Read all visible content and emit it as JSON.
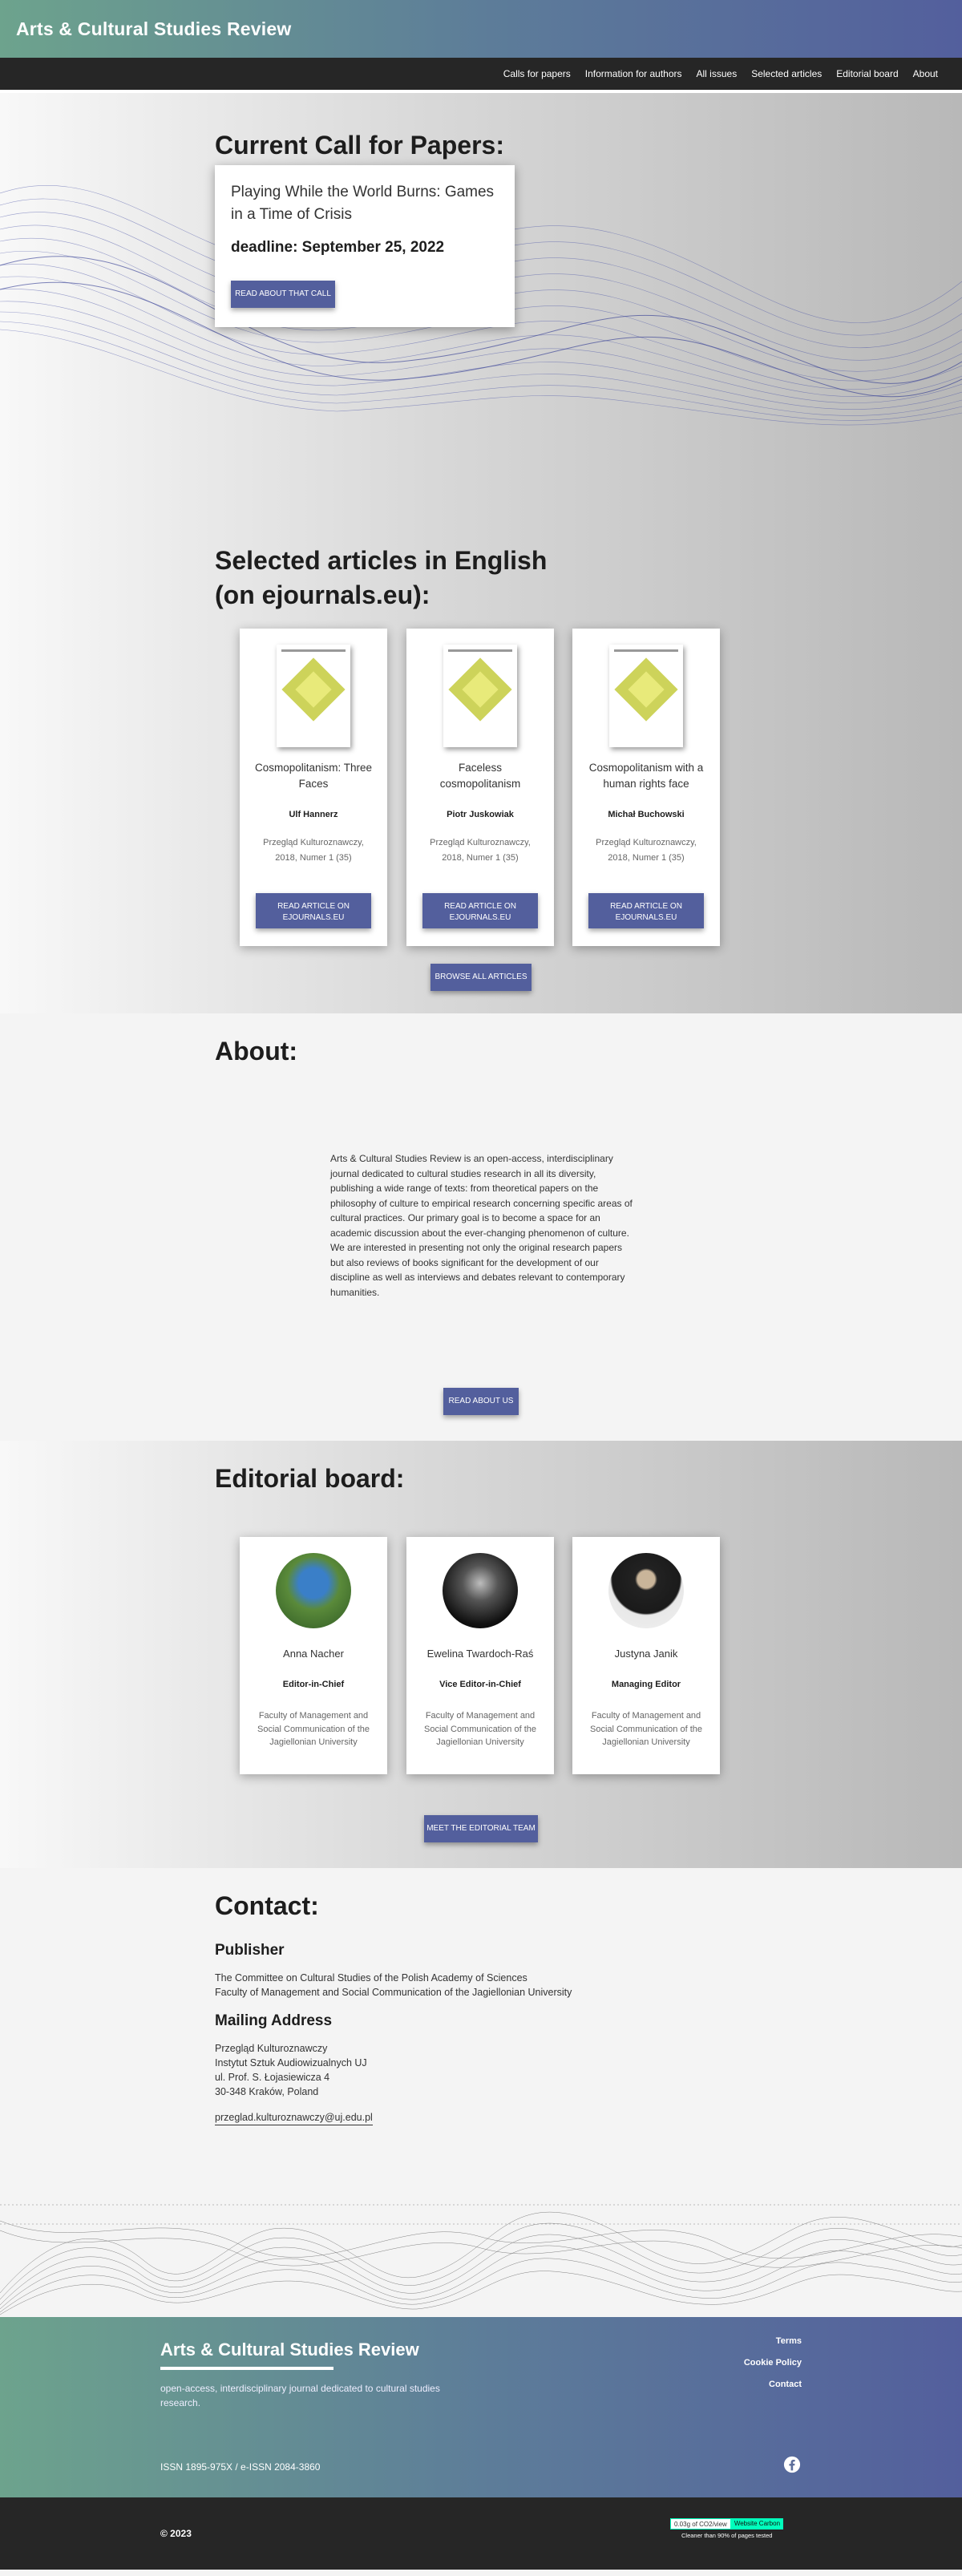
{
  "header": {
    "title": "Arts & Cultural Studies Review"
  },
  "nav": [
    "Calls for papers",
    "Information for authors",
    "All issues",
    "Selected articles",
    "Editorial board",
    "About"
  ],
  "call": {
    "heading": "Current Call for Papers:",
    "title": "Playing While the World Burns: Games in a Time of Crisis",
    "deadline": "deadline: September 25, 2022",
    "button": "READ ABOUT THAT CALL"
  },
  "articles": {
    "heading_line1": "Selected articles in English",
    "heading_line2": "(on ejournals.eu):",
    "items": [
      {
        "title": "Cosmopolitanism: Three Faces",
        "author": "Ulf Hannerz",
        "source": "Przegląd Kulturoznawczy, 2018, Numer 1 (35)",
        "button": "READ ARTICLE ON EJOURNALS.EU"
      },
      {
        "title": "Faceless cosmopolitanism",
        "author": "Piotr Juskowiak",
        "source": "Przegląd Kulturoznawczy, 2018, Numer 1 (35)",
        "button": "READ ARTICLE ON EJOURNALS.EU"
      },
      {
        "title": "Cosmopolitanism with a human rights face",
        "author": "Michał Buchowski",
        "source": "Przegląd Kulturoznawczy, 2018, Numer 1 (35)",
        "button": "READ ARTICLE ON EJOURNALS.EU"
      }
    ],
    "browse_button": "BROWSE ALL ARTICLES"
  },
  "about": {
    "heading": "About:",
    "text": "Arts & Cultural Studies Review is an open-access, interdisciplinary journal dedicated to cultural studies research in all its diversity, publishing a wide range of texts: from theoretical papers on the philosophy of culture to empirical research concerning specific areas of cultural practices. Our primary goal is to become a space for an academic discussion about the ever-changing phenomenon of culture. We are interested in presenting not only the original research papers but also reviews of books significant for the development of our discipline as well as interviews and debates relevant to contemporary humanities.",
    "button": "READ ABOUT US"
  },
  "board": {
    "heading": "Editorial board:",
    "members": [
      {
        "name": "Anna Nacher",
        "role": "Editor-in-Chief",
        "affiliation": "Faculty of Management and Social Communication of the Jagiellonian University"
      },
      {
        "name": "Ewelina Twardoch-Raś",
        "role": "Vice Editor-in-Chief",
        "affiliation": "Faculty of Management and Social Communication of the Jagiellonian University"
      },
      {
        "name": "Justyna Janik",
        "role": "Managing Editor",
        "affiliation": "Faculty of Management and Social Communication of the Jagiellonian University"
      }
    ],
    "button": "MEET THE EDITORIAL TEAM"
  },
  "contact": {
    "heading": "Contact:",
    "publisher_heading": "Publisher",
    "publisher_lines": [
      "The Committee on Cultural Studies of the Polish Academy of Sciences",
      "Faculty of Management and Social Communication of the Jagiellonian University"
    ],
    "mailing_heading": "Mailing Address",
    "mailing_lines": [
      "Przegląd Kulturoznawczy",
      "Instytut Sztuk Audiowizualnych UJ",
      "ul. Prof. S. Łojasiewicza 4",
      "30-348 Kraków, Poland"
    ],
    "email": "przeglad.kulturoznawczy@uj.edu.pl"
  },
  "footer": {
    "title": "Arts & Cultural Studies Review",
    "tagline": "open-access, interdisciplinary journal dedicated to cultural studies research.",
    "links": [
      "Terms",
      "Cookie Policy",
      "Contact"
    ],
    "issn": "ISSN 1895-975X / e-ISSN 2084-3860",
    "copyright": "© 2023",
    "carbon_left": "0.03g of CO2/view",
    "carbon_right": "Website Carbon",
    "carbon_sub": "Cleaner than 90% of pages tested"
  },
  "colors": {
    "accent": "#535f9d",
    "green": "#6da38d",
    "dark": "#262626"
  }
}
